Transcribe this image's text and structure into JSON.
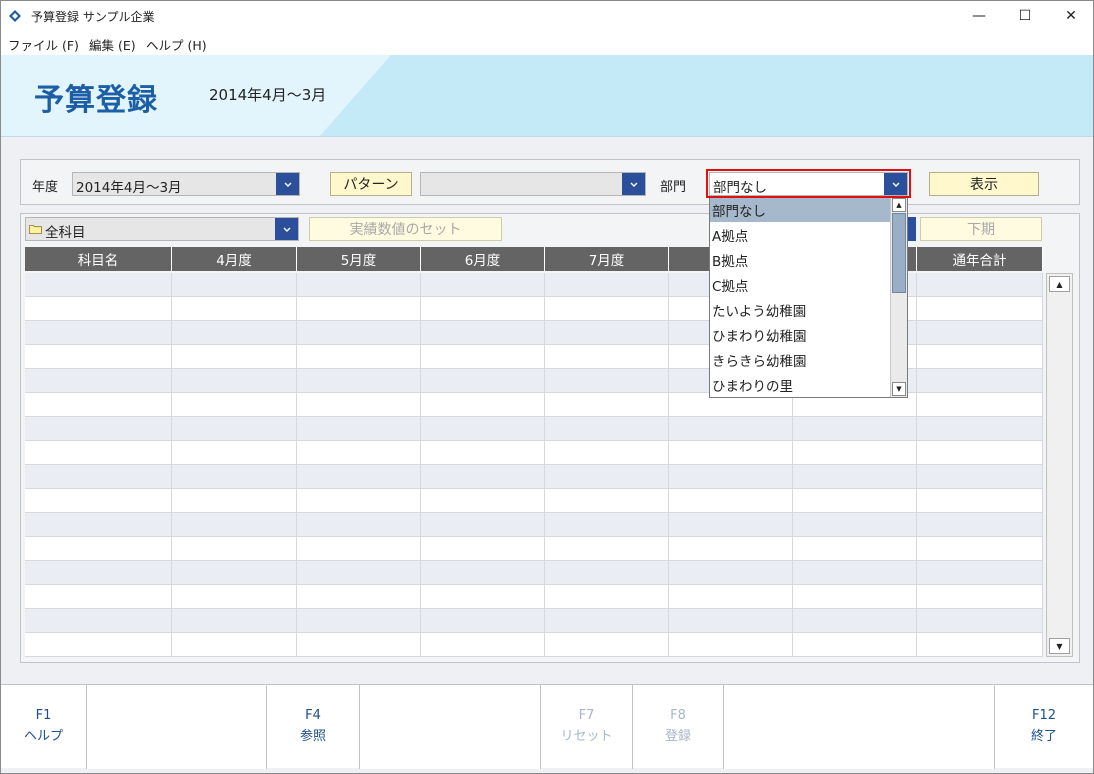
{
  "window": {
    "title": "予算登録 サンプル企業",
    "minimize": "—",
    "maximize": "☐",
    "close": "✕"
  },
  "menu": [
    "ファイル (F)",
    "編集 (E)",
    "ヘルプ (H)"
  ],
  "banner": {
    "title": "予算登録",
    "period": "2014年4月～3月"
  },
  "filters": {
    "year_label": "年度",
    "year_value": "2014年4月～3月",
    "pattern_button": "パターン",
    "pattern_value": "",
    "dept_label": "部門",
    "dept_value": "部門なし",
    "show_button": "表示"
  },
  "subject": {
    "value": "全科目",
    "set_actual_button": "実績数値のセット",
    "second_half_button": "下期"
  },
  "grid": {
    "headers": [
      "科目名",
      "4月度",
      "5月度",
      "6月度",
      "7月度",
      "",
      "",
      "通年合計"
    ],
    "row_count": 16
  },
  "dept_dropdown": {
    "items": [
      "部門なし",
      "A拠点",
      "B拠点",
      "C拠点",
      "たいよう幼稚園",
      "ひまわり幼稚園",
      "きらきら幼稚園",
      "ひまわりの里"
    ],
    "selected_index": 0
  },
  "fkeys": [
    {
      "key": "F1",
      "name": "ヘルプ",
      "enabled": true
    },
    {
      "key": "",
      "name": "",
      "enabled": false
    },
    {
      "key": "F4",
      "name": "参照",
      "enabled": true
    },
    {
      "key": "",
      "name": "",
      "enabled": false
    },
    {
      "key": "F7",
      "name": "リセット",
      "enabled": false
    },
    {
      "key": "F8",
      "name": "登録",
      "enabled": false
    },
    {
      "key": "",
      "name": "",
      "enabled": false
    },
    {
      "key": "F12",
      "name": "終了",
      "enabled": true
    }
  ],
  "colors": {
    "accent_blue": "#2b4f9a",
    "title_blue": "#1d5fa6",
    "header_gray": "#646464",
    "button_yellow": "#fff8cc",
    "highlight_red": "#e01010"
  }
}
